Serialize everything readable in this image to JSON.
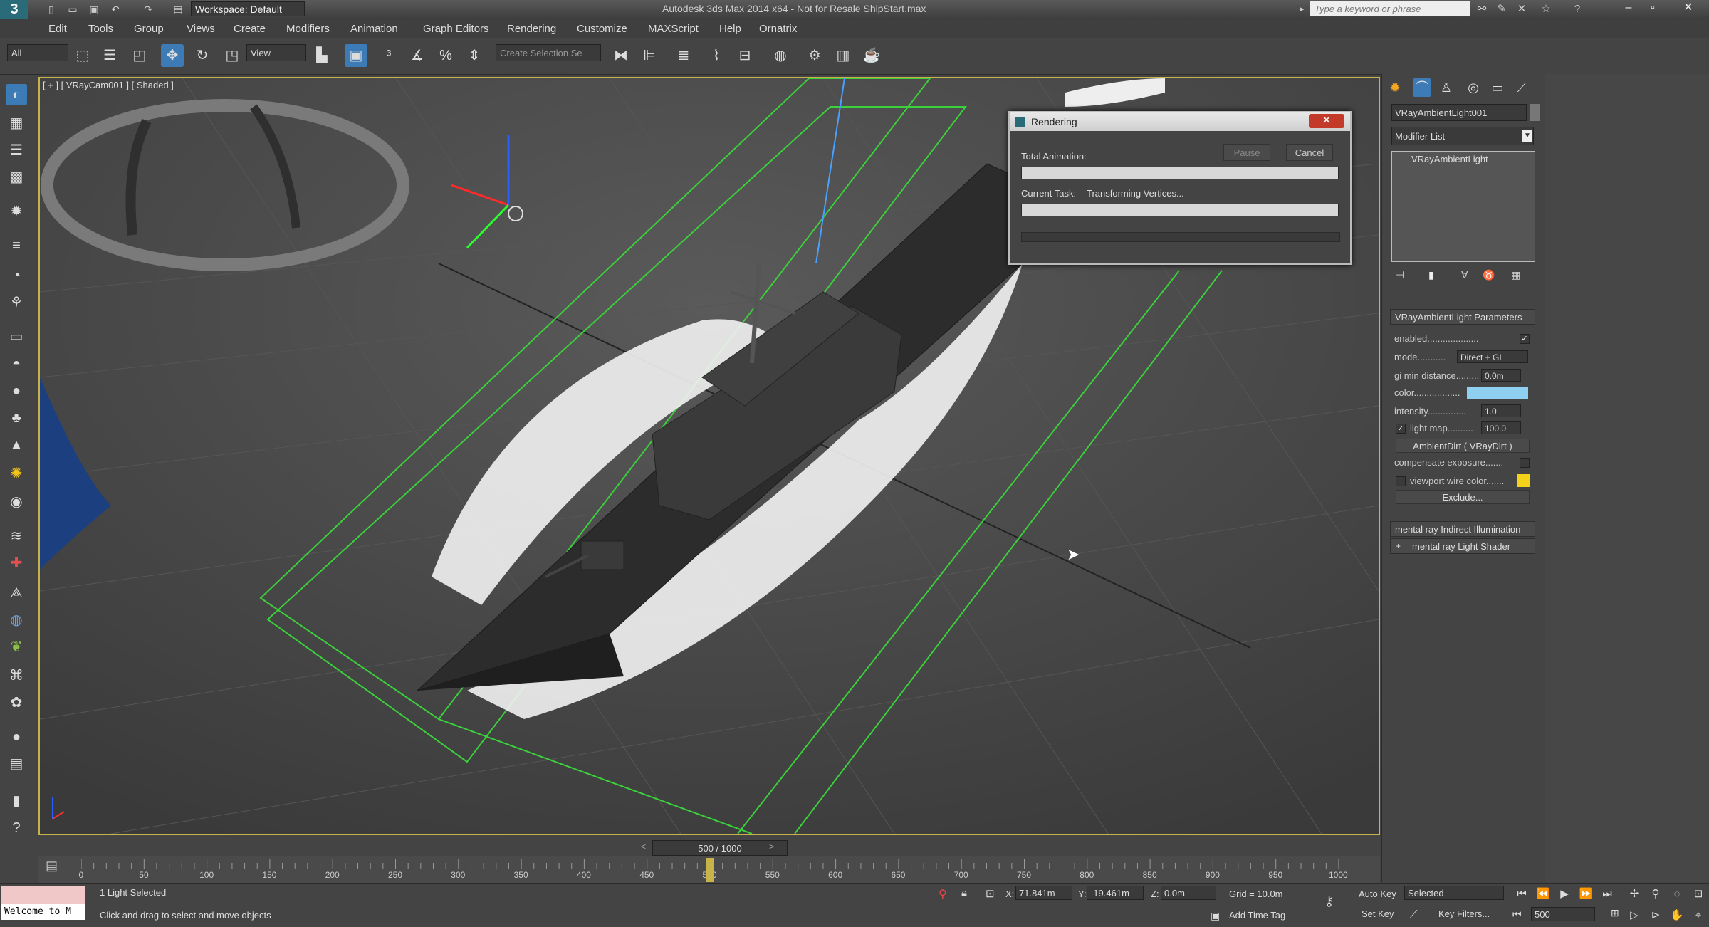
{
  "titlebar": {
    "logo": "3",
    "workspace": "Workspace: Default",
    "title": "Autodesk 3ds Max  2014 x64    - Not for Resale   ShipStart.max",
    "search_placeholder": "Type a keyword or phrase"
  },
  "menu": [
    "Edit",
    "Tools",
    "Group",
    "Views",
    "Create",
    "Modifiers",
    "Animation",
    "Graph Editors",
    "Rendering",
    "Customize",
    "MAXScript",
    "Help",
    "Ornatrix"
  ],
  "toolbar": {
    "selection_filter": "All",
    "reference_coord": "View",
    "named_selection": "Create Selection Se"
  },
  "viewport": {
    "label": "[ + ] [ VRayCam001 ] [ Shaded ]"
  },
  "render_dialog": {
    "title": "Rendering",
    "pause": "Pause",
    "cancel": "Cancel",
    "total_animation_label": "Total Animation:",
    "current_task_label": "Current Task:",
    "current_task_value": "Transforming Vertices...",
    "total_progress": 1.0,
    "task_progress": 1.0
  },
  "command_panel": {
    "object_name": "VRayAmbientLight001",
    "modifier_list": "Modifier List",
    "stack_item": "VRayAmbientLight",
    "rollout_title": "VRayAmbientLight Parameters",
    "params": {
      "enabled": "enabled....................",
      "mode_label": "mode...........",
      "mode_value": "Direct + GI",
      "gi_min_label": "gi min distance.........",
      "gi_min_value": "0.0m",
      "color_label": "color..................",
      "color_value": "#8fcff0",
      "intensity_label": "intensity...............",
      "intensity_value": "1.0",
      "lightmap_label": "light map..........",
      "lightmap_value": "100.0",
      "ambientdirt": "AmbientDirt  ( VRayDirt )",
      "compensate_label": "compensate exposure.......",
      "wirecolor_label": "viewport wire color.......",
      "wirecolor_value": "#f5d21a",
      "exclude": "Exclude..."
    },
    "rollout_mr_indirect": "mental ray Indirect Illumination",
    "rollout_mr_shader": "mental ray Light Shader"
  },
  "timeline": {
    "slider_text": "500 / 1000",
    "ticks": [
      "0",
      "50",
      "100",
      "150",
      "200",
      "250",
      "300",
      "350",
      "400",
      "450",
      "500",
      "550",
      "600",
      "650",
      "700",
      "750",
      "800",
      "850",
      "900",
      "950",
      "1000"
    ],
    "current_frame": 500,
    "total_frames": 1000
  },
  "status": {
    "welcome": "Welcome to M",
    "selected": "1 Light Selected",
    "prompt": "Click and drag to select and move objects",
    "x_value": "71.841m",
    "y_value": "-19.461m",
    "z_value": "0.0m",
    "grid": "Grid = 10.0m",
    "add_time_tag": "Add Time Tag",
    "auto_key": "Auto Key",
    "set_key": "Set Key",
    "selected_set": "Selected",
    "key_filters": "Key Filters...",
    "frame_value": "500"
  }
}
